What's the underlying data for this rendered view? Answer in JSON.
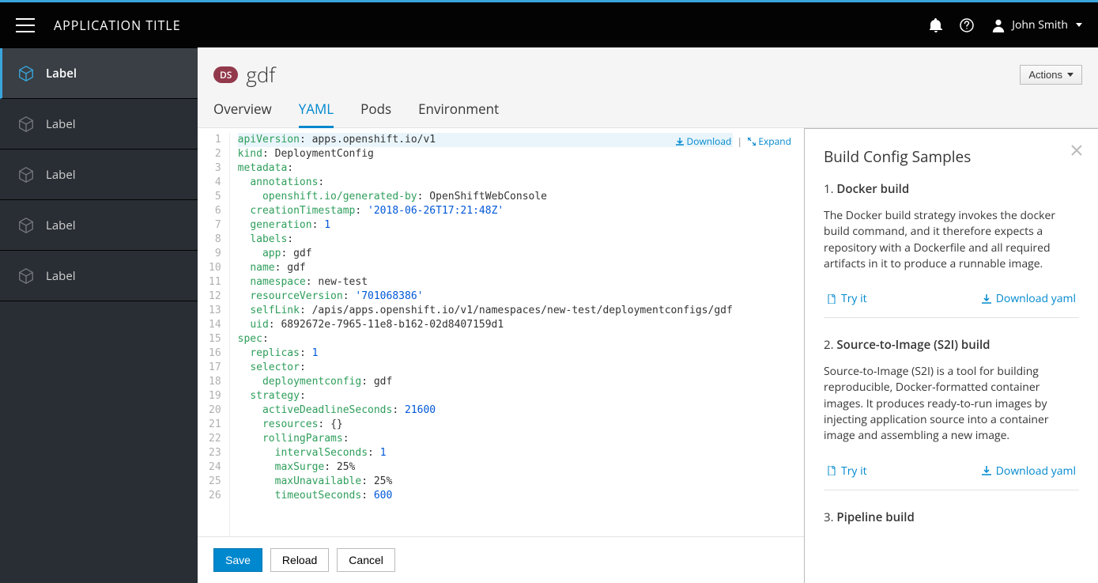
{
  "app_title": "APPLICATION TITLE",
  "user_name": "John Smith",
  "sidebar": {
    "items": [
      {
        "label": "Label"
      },
      {
        "label": "Label"
      },
      {
        "label": "Label"
      },
      {
        "label": "Label"
      },
      {
        "label": "Label"
      }
    ]
  },
  "page": {
    "badge": "DS",
    "title": "gdf",
    "actions_label": "Actions"
  },
  "tabs": [
    "Overview",
    "YAML",
    "Pods",
    "Environment"
  ],
  "active_tab": 1,
  "editor_links": {
    "download": "Download",
    "expand": "Expand"
  },
  "buttons": {
    "save": "Save",
    "reload": "Reload",
    "cancel": "Cancel"
  },
  "yaml_lines": [
    [
      [
        "k",
        "apiVersion"
      ],
      [
        "p",
        ": "
      ],
      [
        "p",
        "apps.openshift.io/v1"
      ]
    ],
    [
      [
        "k",
        "kind"
      ],
      [
        "p",
        ": "
      ],
      [
        "p",
        "DeploymentConfig"
      ]
    ],
    [
      [
        "k",
        "metadata"
      ],
      [
        "p",
        ":"
      ]
    ],
    [
      [
        "p",
        "  "
      ],
      [
        "k",
        "annotations"
      ],
      [
        "p",
        ":"
      ]
    ],
    [
      [
        "p",
        "    "
      ],
      [
        "k",
        "openshift.io/generated-by"
      ],
      [
        "p",
        ": "
      ],
      [
        "p",
        "OpenShiftWebConsole"
      ]
    ],
    [
      [
        "p",
        "  "
      ],
      [
        "k",
        "creationTimestamp"
      ],
      [
        "p",
        ": "
      ],
      [
        "s",
        "'2018-06-26T17:21:48Z'"
      ]
    ],
    [
      [
        "p",
        "  "
      ],
      [
        "k",
        "generation"
      ],
      [
        "p",
        ": "
      ],
      [
        "n",
        "1"
      ]
    ],
    [
      [
        "p",
        "  "
      ],
      [
        "k",
        "labels"
      ],
      [
        "p",
        ":"
      ]
    ],
    [
      [
        "p",
        "    "
      ],
      [
        "k",
        "app"
      ],
      [
        "p",
        ": "
      ],
      [
        "p",
        "gdf"
      ]
    ],
    [
      [
        "p",
        "  "
      ],
      [
        "k",
        "name"
      ],
      [
        "p",
        ": "
      ],
      [
        "p",
        "gdf"
      ]
    ],
    [
      [
        "p",
        "  "
      ],
      [
        "k",
        "namespace"
      ],
      [
        "p",
        ": "
      ],
      [
        "p",
        "new-test"
      ]
    ],
    [
      [
        "p",
        "  "
      ],
      [
        "k",
        "resourceVersion"
      ],
      [
        "p",
        ": "
      ],
      [
        "s",
        "'701068386'"
      ]
    ],
    [
      [
        "p",
        "  "
      ],
      [
        "k",
        "selfLink"
      ],
      [
        "p",
        ": "
      ],
      [
        "p",
        "/apis/apps.openshift.io/v1/namespaces/new-test/deploymentconfigs/gdf"
      ]
    ],
    [
      [
        "p",
        "  "
      ],
      [
        "k",
        "uid"
      ],
      [
        "p",
        ": "
      ],
      [
        "p",
        "6892672e-7965-11e8-b162-02d8407159d1"
      ]
    ],
    [
      [
        "k",
        "spec"
      ],
      [
        "p",
        ":"
      ]
    ],
    [
      [
        "p",
        "  "
      ],
      [
        "k",
        "replicas"
      ],
      [
        "p",
        ": "
      ],
      [
        "n",
        "1"
      ]
    ],
    [
      [
        "p",
        "  "
      ],
      [
        "k",
        "selector"
      ],
      [
        "p",
        ":"
      ]
    ],
    [
      [
        "p",
        "    "
      ],
      [
        "k",
        "deploymentconfig"
      ],
      [
        "p",
        ": "
      ],
      [
        "p",
        "gdf"
      ]
    ],
    [
      [
        "p",
        "  "
      ],
      [
        "k",
        "strategy"
      ],
      [
        "p",
        ":"
      ]
    ],
    [
      [
        "p",
        "    "
      ],
      [
        "k",
        "activeDeadlineSeconds"
      ],
      [
        "p",
        ": "
      ],
      [
        "n",
        "21600"
      ]
    ],
    [
      [
        "p",
        "    "
      ],
      [
        "k",
        "resources"
      ],
      [
        "p",
        ": "
      ],
      [
        "p",
        "{}"
      ]
    ],
    [
      [
        "p",
        "    "
      ],
      [
        "k",
        "rollingParams"
      ],
      [
        "p",
        ":"
      ]
    ],
    [
      [
        "p",
        "      "
      ],
      [
        "k",
        "intervalSeconds"
      ],
      [
        "p",
        ": "
      ],
      [
        "n",
        "1"
      ]
    ],
    [
      [
        "p",
        "      "
      ],
      [
        "k",
        "maxSurge"
      ],
      [
        "p",
        ": "
      ],
      [
        "p",
        "25%"
      ]
    ],
    [
      [
        "p",
        "      "
      ],
      [
        "k",
        "maxUnavailable"
      ],
      [
        "p",
        ": "
      ],
      [
        "p",
        "25%"
      ]
    ],
    [
      [
        "p",
        "      "
      ],
      [
        "k",
        "timeoutSeconds"
      ],
      [
        "p",
        ": "
      ],
      [
        "n",
        "600"
      ]
    ]
  ],
  "samples_panel": {
    "title": "Build Config Samples",
    "try_label": "Try it",
    "download_label": "Download yaml",
    "items": [
      {
        "title": "Docker build",
        "desc": "The Docker build strategy invokes the docker build command, and it therefore expects a repository with a Dockerfile and all required artifacts in it to produce a runnable image."
      },
      {
        "title": "Source-to-Image (S2I) build",
        "desc": "Source-to-Image (S2I) is a tool for building reproducible, Docker-formatted container images. It produces ready-to-run images by injecting application source into a container image and assembling a new image."
      },
      {
        "title": "Pipeline build",
        "desc": ""
      }
    ]
  }
}
